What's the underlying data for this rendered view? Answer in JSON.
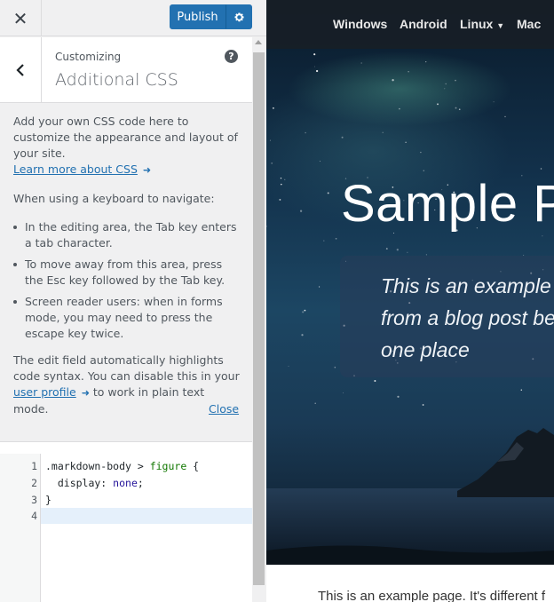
{
  "topbar": {
    "close_label": "✕",
    "publish_label": "Publish",
    "settings_icon": "gear-icon"
  },
  "panel": {
    "customizing": "Customizing",
    "title": "Additional CSS",
    "help": "?"
  },
  "description": {
    "intro": "Add your own CSS code here to customize the appearance and layout of your site.",
    "learn_more": "Learn more about CSS",
    "keyboard_heading": "When using a keyboard to navigate:",
    "bullets": [
      "In the editing area, the Tab key enters a tab character.",
      "To move away from this area, press the Esc key followed by the Tab key.",
      "Screen reader users: when in forms mode, you may need to press the escape key twice."
    ],
    "highlight_before": "The edit field automatically highlights code syntax. You can disable this in your ",
    "user_profile": "user profile",
    "highlight_after": " to work in plain text mode.",
    "close": "Close"
  },
  "editor": {
    "lines": [
      {
        "num": "1",
        "sel": ".markdown-body > ",
        "tag": "figure",
        "rest": " {"
      },
      {
        "num": "2",
        "prop": "  display: ",
        "val": "none",
        "end": ";"
      },
      {
        "num": "3",
        "code": "}"
      },
      {
        "num": "4",
        "code": ""
      }
    ]
  },
  "preview": {
    "nav": [
      "Windows",
      "Android",
      "Linux",
      "Mac"
    ],
    "nav_dropdown_icon": "caret-down-icon",
    "hero_title": "Sample P",
    "hero_subtitle": [
      "This is an example",
      "from a blog post be",
      "one place"
    ],
    "body_text": "This is an example page. It's different f"
  }
}
